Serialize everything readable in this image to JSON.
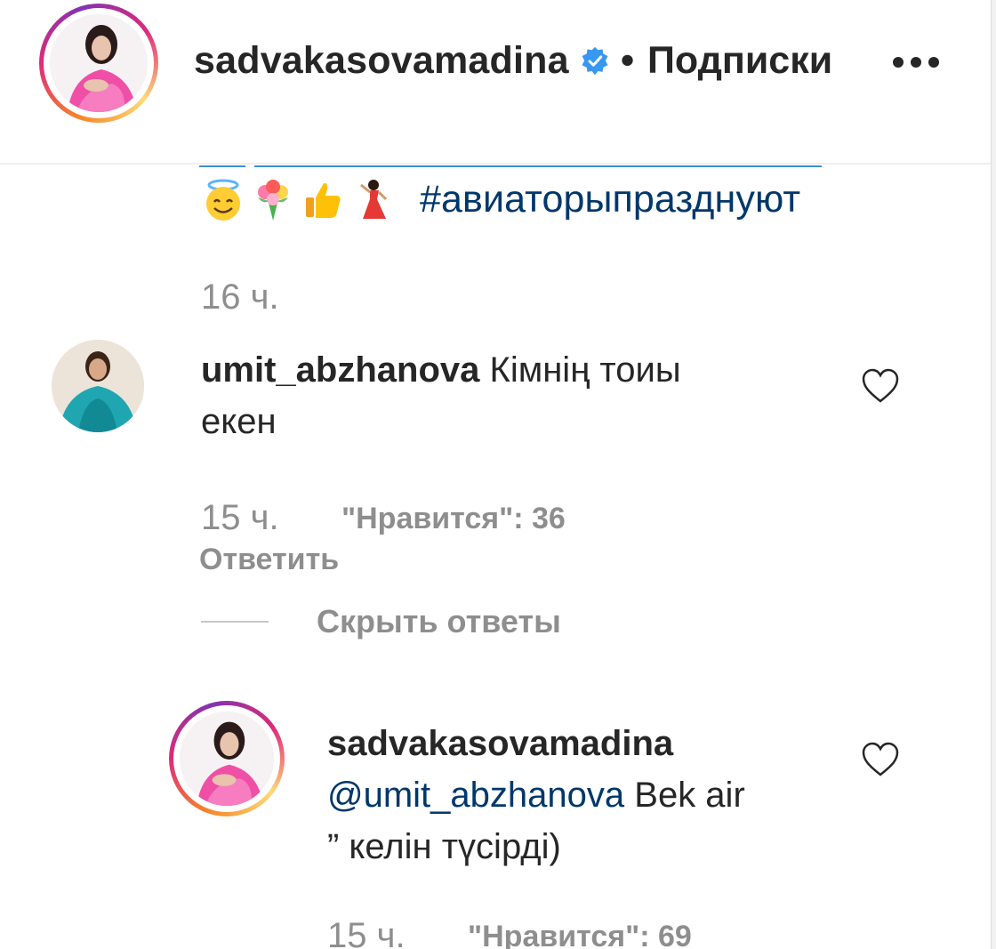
{
  "post_header": {
    "username": "sadvakasovamadina",
    "separator": "•",
    "follow_label": "Подписки",
    "verified_icon": "verified-badge-icon",
    "more_icon": "more-options-icon"
  },
  "caption": {
    "emojis": [
      "smiling-face-with-halo",
      "bouquet",
      "thumbs-up",
      "woman-dancing"
    ],
    "hashtag": "#авиаторыпразднуют",
    "time": "16 ч."
  },
  "comments": [
    {
      "username": "umit_abzhanova",
      "text_line1": "Кімнің тоиы",
      "text_line2": "екен",
      "time": "15 ч.",
      "likes": "\"Нравится\": 36",
      "reply_label": "Ответить",
      "hide_replies_label": "Скрыть ответы",
      "replies": [
        {
          "username": "sadvakasovamadina",
          "mention": "@umit_abzhanova",
          "text_line1": "Bek air",
          "text_line2": "” келін түсірді)",
          "time": "15 ч.",
          "likes": "\"Нравится\": 69"
        }
      ]
    }
  ],
  "colors": {
    "text": "#262626",
    "muted": "#8e8e8e",
    "link": "#00376b",
    "verified": "#3897f0"
  }
}
